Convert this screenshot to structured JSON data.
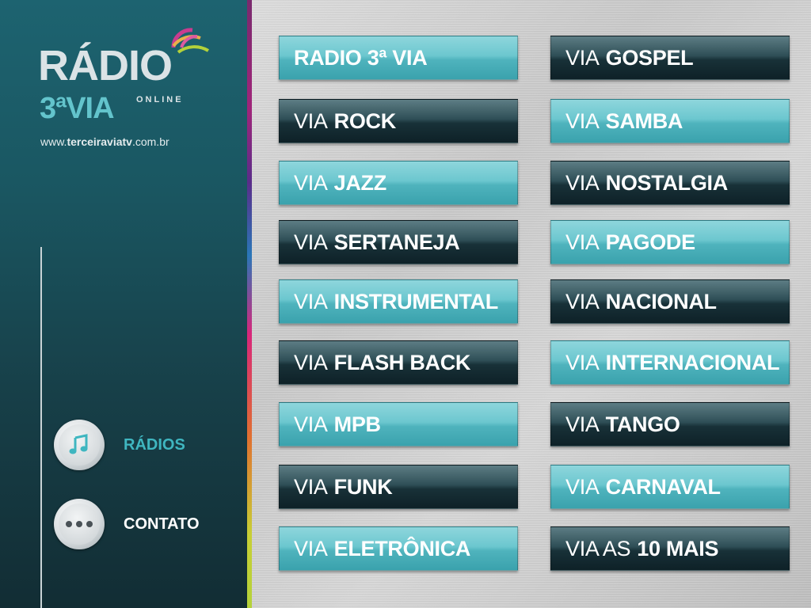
{
  "logo": {
    "title": "RÁDIO",
    "subtitle": "3ªVIA",
    "tag": "ONLINE",
    "url_prefix": "www.",
    "url_brand": "terceiraviatv",
    "url_suffix": ".com.br"
  },
  "nav": {
    "radios_label": "RÁDIOS",
    "contato_label": "CONTATO"
  },
  "colors": {
    "active_nav": "#3fb6c0",
    "inactive_nav": "#ffffff",
    "button_light": "#6cc7cf",
    "button_dark": "#183138"
  },
  "stations_left": [
    {
      "prefix": "",
      "name": "RADIO 3ª VIA",
      "style": "light"
    },
    {
      "prefix": "VIA",
      "name": "ROCK",
      "style": "dark"
    },
    {
      "prefix": "VIA",
      "name": "JAZZ",
      "style": "light"
    },
    {
      "prefix": "VIA",
      "name": "SERTANEJA",
      "style": "dark"
    },
    {
      "prefix": "VIA",
      "name": "INSTRUMENTAL",
      "style": "light"
    },
    {
      "prefix": "VIA",
      "name": "FLASH BACK",
      "style": "dark"
    },
    {
      "prefix": "VIA",
      "name": "MPB",
      "style": "light"
    },
    {
      "prefix": "VIA",
      "name": "FUNK",
      "style": "dark"
    },
    {
      "prefix": "VIA",
      "name": "ELETRÔNICA",
      "style": "light"
    }
  ],
  "stations_right": [
    {
      "prefix": "VIA",
      "name": "GOSPEL",
      "style": "dark"
    },
    {
      "prefix": "VIA",
      "name": "SAMBA",
      "style": "light"
    },
    {
      "prefix": "VIA",
      "name": "NOSTALGIA",
      "style": "dark"
    },
    {
      "prefix": "VIA",
      "name": "PAGODE",
      "style": "light"
    },
    {
      "prefix": "VIA",
      "name": "NACIONAL",
      "style": "dark"
    },
    {
      "prefix": "VIA",
      "name": "INTERNACIONAL",
      "style": "light"
    },
    {
      "prefix": "VIA",
      "name": "TANGO",
      "style": "dark"
    },
    {
      "prefix": "VIA",
      "name": "CARNAVAL",
      "style": "light"
    },
    {
      "prefix": "VIA AS",
      "name": "10 MAIS",
      "style": "dark"
    }
  ]
}
